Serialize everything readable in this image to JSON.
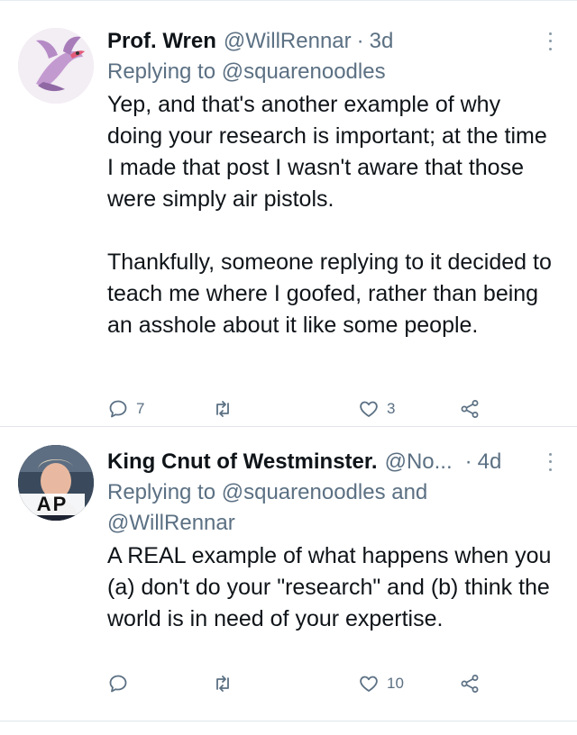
{
  "tweets": [
    {
      "author_name": "Prof. Wren",
      "handle": "@WillRennar",
      "separator": "·",
      "time": "3d",
      "replying_prefix": "Replying to",
      "replying_to": "@squarenoodles",
      "paragraphs": [
        "Yep, and that's another example of why doing your research is important; at the time I made that post I wasn't aware that those were simply air pistols.",
        "Thankfully, someone replying to it decided to teach me where I goofed, rather than being an asshole about it like some people."
      ],
      "reply_count": "7",
      "retweet_count": "",
      "like_count": "3"
    },
    {
      "author_name": "King Cnut of Westminster.",
      "handle": "@No...",
      "separator": "·",
      "time": "4d",
      "replying_prefix": "Replying to",
      "replying_to": "@squarenoodles and @WillRennar",
      "paragraphs": [
        "A REAL example of what happens when you (a) don't do your \"research\" and (b) think the world is in need of your expertise."
      ],
      "reply_count": "",
      "retweet_count": "",
      "like_count": "10",
      "avatar_overlay_text": "AP"
    }
  ],
  "icons": {
    "reply": "reply-icon",
    "retweet": "retweet-icon",
    "like": "heart-icon",
    "share": "share-icon",
    "more": "more-options-icon"
  },
  "colors": {
    "text": "#0f1419",
    "secondary": "#5b7083",
    "divider": "#e1e6ea"
  }
}
